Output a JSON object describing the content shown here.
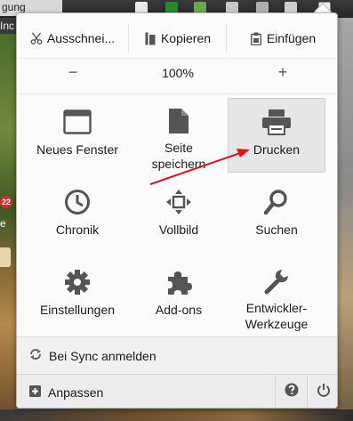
{
  "background": {
    "url_fragment": "gung",
    "tab_fragment": "Inc",
    "badge_count": "22",
    "side_text": "e"
  },
  "edit": {
    "cut_label": "Ausschnei...",
    "copy_label": "Kopieren",
    "paste_label": "Einfügen"
  },
  "zoom": {
    "minus": "−",
    "value": "100%",
    "plus": "+"
  },
  "tiles": [
    {
      "label": "Neues Fenster",
      "icon": "new-window-icon"
    },
    {
      "label": "Seite\nspeichern",
      "icon": "save-page-icon"
    },
    {
      "label": "Drucken",
      "icon": "print-icon"
    },
    {
      "label": "Chronik",
      "icon": "history-clock-icon"
    },
    {
      "label": "Vollbild",
      "icon": "fullscreen-icon"
    },
    {
      "label": "Suchen",
      "icon": "search-icon"
    },
    {
      "label": "Einstellungen",
      "icon": "gear-icon"
    },
    {
      "label": "Add-ons",
      "icon": "puzzle-icon"
    },
    {
      "label": "Entwickler-\nWerkzeuge",
      "icon": "wrench-icon"
    }
  ],
  "sync": {
    "label": "Bei Sync anmelden"
  },
  "footer": {
    "customize_label": "Anpassen",
    "help_icon": "help-icon",
    "quit_icon": "power-icon"
  },
  "colors": {
    "icon_gray": "#555555",
    "annotation_arrow": "#e0141e",
    "hover_bg": "#e6e6e6"
  }
}
